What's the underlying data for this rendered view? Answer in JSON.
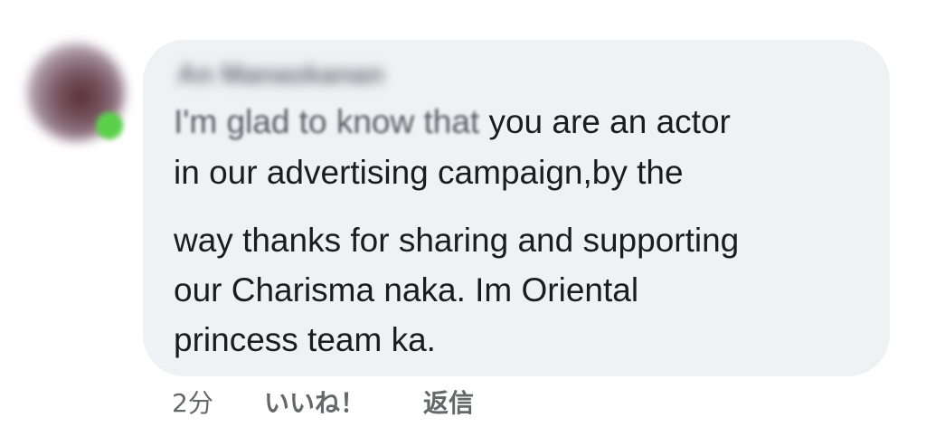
{
  "comment": {
    "author_name": "An Manaskanan",
    "text_line_1_blurred": "I'm glad to know that",
    "text_line_1_rest": " you are an actor",
    "text_line_2": "in our advertising campaign,by the",
    "text_line_3": "way thanks for sharing and supporting",
    "text_line_4": "our Charisma naka. Im Oriental",
    "text_line_5": "princess team ka."
  },
  "meta": {
    "timestamp": "2分",
    "like_label": "いいね！",
    "reply_label": "返信"
  },
  "colors": {
    "bubble_background": "#f0f1f5",
    "online_indicator": "#5ad04a",
    "meta_text": "#65676b"
  }
}
